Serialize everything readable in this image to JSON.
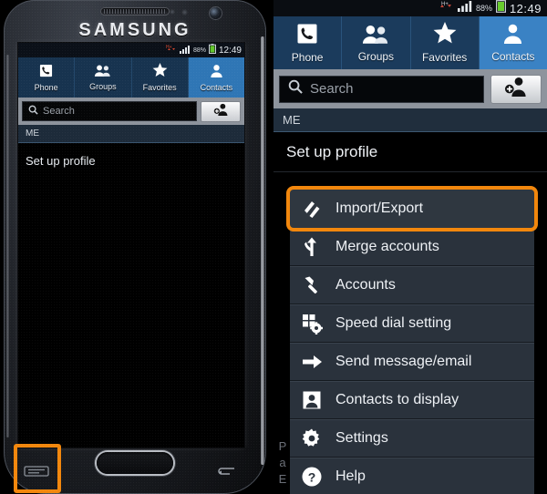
{
  "device": {
    "brand": "SAMSUNG"
  },
  "status_bar": {
    "network": "H+",
    "battery_percent": "88%",
    "time": "12:49",
    "icons": [
      "hplus-network-icon",
      "signal-bars-icon",
      "battery-icon"
    ]
  },
  "tabs": [
    {
      "label": "Phone",
      "icon": "phone-handset-icon",
      "active": false
    },
    {
      "label": "Groups",
      "icon": "groups-people-icon",
      "active": false
    },
    {
      "label": "Favorites",
      "icon": "star-icon",
      "active": false
    },
    {
      "label": "Contacts",
      "icon": "contact-person-icon",
      "active": true
    }
  ],
  "search": {
    "placeholder": "Search",
    "value": "",
    "icon": "search-magnifier-icon"
  },
  "add_contact_button": {
    "icon": "add-contact-icon",
    "label": ""
  },
  "section_header": {
    "label": "ME"
  },
  "profile_row": {
    "label": "Set up profile"
  },
  "ghost_text": [
    "P",
    "a",
    "E"
  ],
  "menu": {
    "highlight_color": "#f2870d",
    "items": [
      {
        "label": "Import/Export",
        "icon": "import-export-arrows-icon",
        "selected": true
      },
      {
        "label": "Merge accounts",
        "icon": "merge-arrow-icon",
        "selected": false
      },
      {
        "label": "Accounts",
        "icon": "accounts-key-icon",
        "selected": false
      },
      {
        "label": "Speed dial setting",
        "icon": "speed-dial-keypad-icon",
        "selected": false
      },
      {
        "label": "Send message/email",
        "icon": "send-arrow-right-icon",
        "selected": false
      },
      {
        "label": "Contacts to display",
        "icon": "contact-card-icon",
        "selected": false
      },
      {
        "label": "Settings",
        "icon": "gear-icon",
        "selected": false
      },
      {
        "label": "Help",
        "icon": "help-question-icon",
        "selected": false
      }
    ]
  },
  "hardware_keys": [
    {
      "name": "menu-key",
      "highlighted": true
    },
    {
      "name": "home-button",
      "highlighted": false
    },
    {
      "name": "back-key",
      "highlighted": false
    }
  ]
}
